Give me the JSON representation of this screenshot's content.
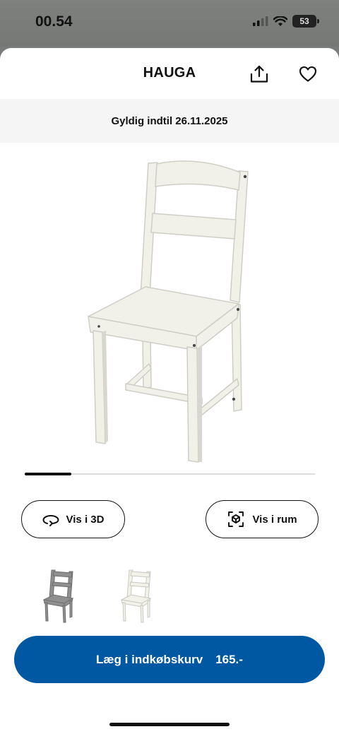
{
  "status": {
    "time": "00.54",
    "battery": "53"
  },
  "header": {
    "title": "HAUGA"
  },
  "validity": {
    "text": "Gyldig indtil 26.11.2025"
  },
  "gallery": {
    "progress_fraction": 0.16
  },
  "actions": {
    "view_3d_label": "Vis i 3D",
    "view_room_label": "Vis i rum"
  },
  "variants": [
    {
      "color": "#8f8f8f"
    },
    {
      "color": "#f2f1ea"
    }
  ],
  "cart": {
    "label": "Læg i indkøbskurv",
    "price": "165.-"
  },
  "colors": {
    "accent": "#0058a3",
    "chair": "#f1f0e9",
    "chair_shade": "#d8d7cf"
  }
}
